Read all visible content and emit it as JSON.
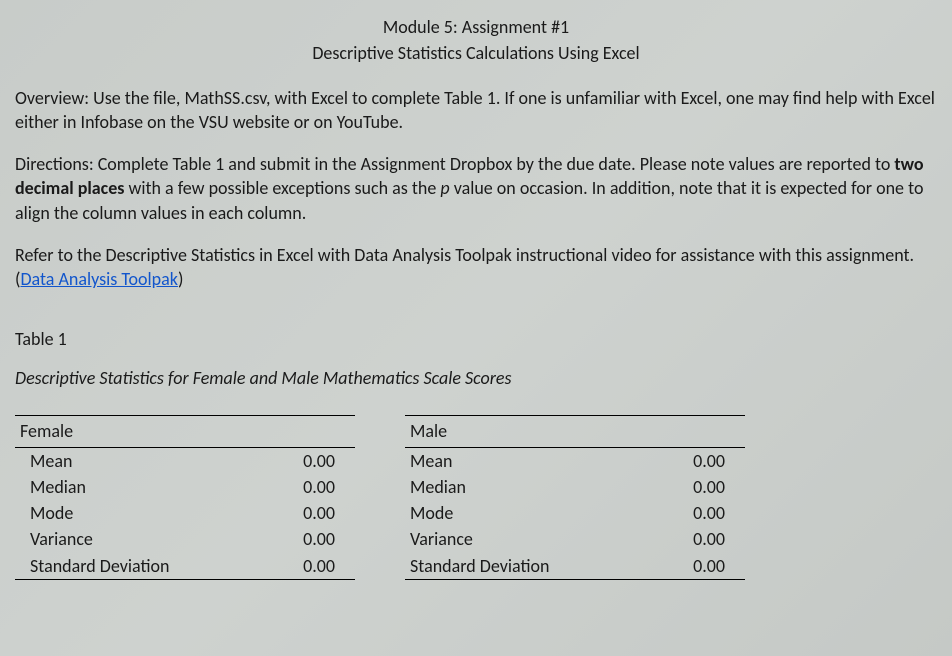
{
  "header": {
    "line1": "Module 5:  Assignment #1",
    "line2": "Descriptive Statistics Calculations Using Excel"
  },
  "overview": {
    "prefix": "Overview: Use the file, MathSS.csv, with Excel to complete Table 1. If one is unfamiliar with Excel, one may find help with Excel either in Infobase on the VSU website or on YouTube."
  },
  "directions": {
    "part1": "Directions:  Complete Table 1 and submit in the Assignment Dropbox by the due date. Please note values are reported to ",
    "bold": "two decimal places",
    "part2": " with a few possible exceptions such as the ",
    "italic": "p",
    "part3": " value on occasion. In addition, note that it is expected for one to align the column values in each column."
  },
  "refer": {
    "part1": "Refer to the Descriptive Statistics in Excel with Data Analysis Toolpak instructional video for assistance with this assignment. (",
    "link": "Data Analysis Toolpak",
    "part2": ")"
  },
  "table": {
    "heading": "Table 1",
    "caption": "Descriptive Statistics for Female and Male Mathematics Scale Scores",
    "female_header": "Female",
    "male_header": "Male",
    "rows": {
      "mean": "Mean",
      "median": "Median",
      "mode": "Mode",
      "variance": "Variance",
      "sd": "Standard Deviation"
    },
    "female_values": {
      "mean": "0.00",
      "median": "0.00",
      "mode": "0.00",
      "variance": "0.00",
      "sd": "0.00"
    },
    "male_values": {
      "mean": "0.00",
      "median": "0.00",
      "mode": "0.00",
      "variance": "0.00",
      "sd": "0.00"
    }
  }
}
